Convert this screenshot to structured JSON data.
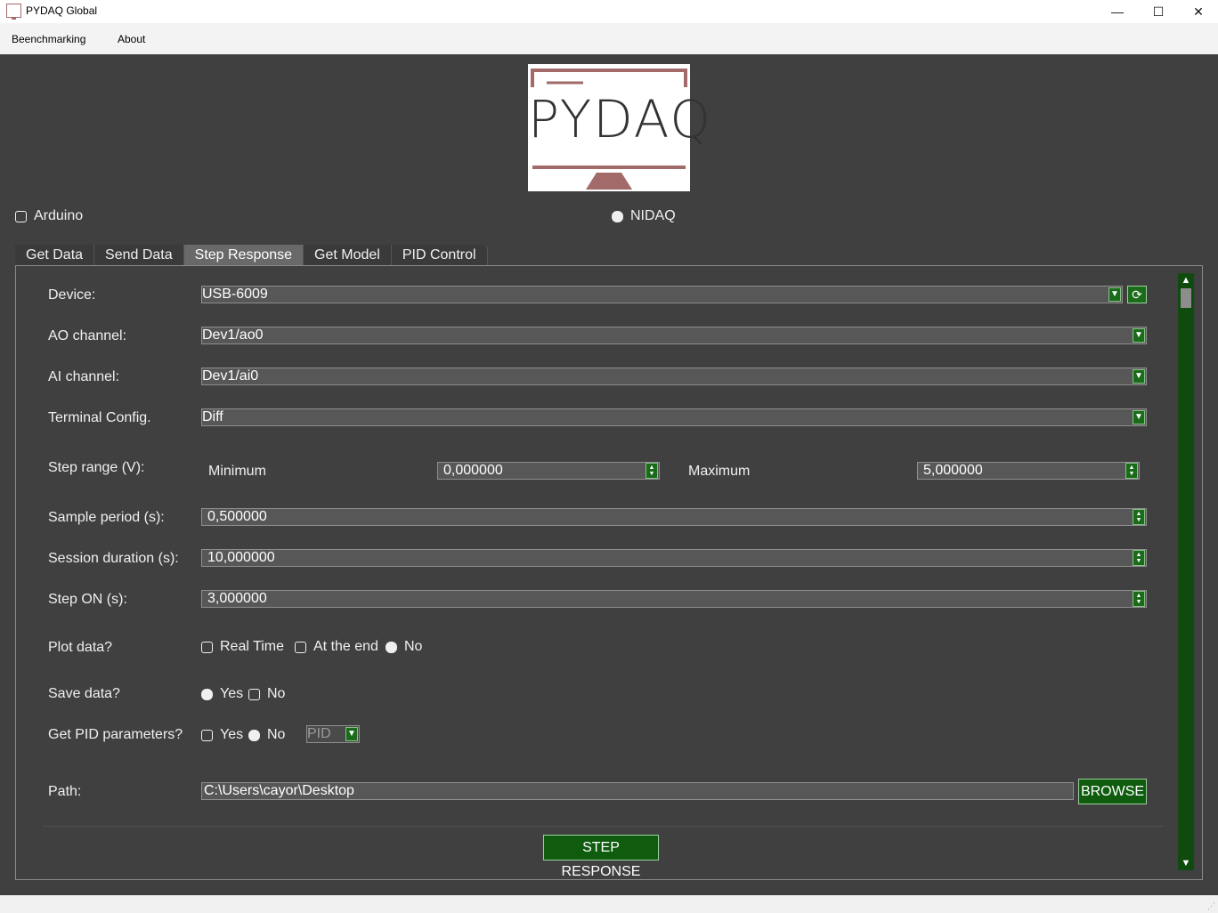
{
  "window": {
    "title": "PYDAQ Global",
    "minimize": "—",
    "maximize": "☐",
    "close": "✕"
  },
  "menu": {
    "benchmark": "Beenchmarking",
    "about": "About"
  },
  "logo": {
    "text": "PYDAQ"
  },
  "board": {
    "arduino": "Arduino",
    "nidaq": "NIDAQ"
  },
  "tabs": [
    "Get Data",
    "Send Data",
    "Step Response",
    "Get Model",
    "PID Control"
  ],
  "active_tab": "Step Response",
  "form": {
    "device_label": "Device:",
    "device_value": "USB-6009",
    "ao_label": "AO channel:",
    "ao_value": "Dev1/ao0",
    "ai_label": "AI channel:",
    "ai_value": "Dev1/ai0",
    "terminal_label": "Terminal Config.",
    "terminal_value": "Diff",
    "step_range_label": "Step range (V):",
    "min_label": "Minimum",
    "min_value": "0,000000",
    "max_label": "Maximum",
    "max_value": "5,000000",
    "sample_label": "Sample period (s):",
    "sample_value": "0,500000",
    "session_label": "Session duration (s):",
    "session_value": "10,000000",
    "step_on_label": "Step ON (s):",
    "step_on_value": "3,000000",
    "plot_label": "Plot data?",
    "plot_realtime": "Real Time",
    "plot_end": "At the end",
    "plot_no": "No",
    "save_label": "Save data?",
    "save_yes": "Yes",
    "save_no": "No",
    "pid_label": "Get PID parameters?",
    "pid_yes": "Yes",
    "pid_no": "No",
    "pid_select": "PID",
    "path_label": "Path:",
    "path_value": "C:\\Users\\cayor\\Desktop",
    "browse": "BROWSE",
    "run": "STEP RESPONSE"
  },
  "colors": {
    "accent": "#0f5c0f",
    "background": "#404040",
    "field": "#575757"
  }
}
